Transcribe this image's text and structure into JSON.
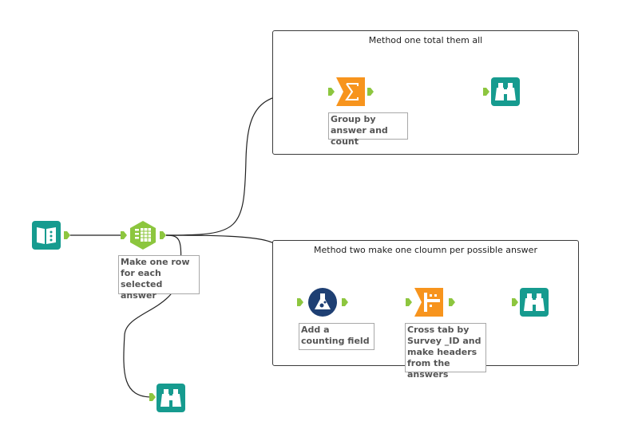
{
  "containers": {
    "method_one": {
      "title": "Method one total them all"
    },
    "method_two": {
      "title": "Method two make one cloumn per possible answer"
    }
  },
  "annotations": {
    "text_to_columns": "Make one row for each selected answer",
    "summarize": "Group by answer and count",
    "formula": "Add a counting field",
    "crosstab": "Cross tab by Survey _ID and make headers from the answers"
  },
  "tools": [
    {
      "id": "input",
      "icon": "book-input-icon"
    },
    {
      "id": "text_to_columns",
      "icon": "text-to-columns-icon"
    },
    {
      "id": "summarize",
      "icon": "sigma-icon"
    },
    {
      "id": "browse_1",
      "icon": "binoculars-icon"
    },
    {
      "id": "formula",
      "icon": "flask-icon"
    },
    {
      "id": "crosstab",
      "icon": "crosstab-icon"
    },
    {
      "id": "browse_2",
      "icon": "binoculars-icon"
    },
    {
      "id": "browse_3",
      "icon": "binoculars-icon"
    }
  ],
  "colors": {
    "teal": "#169B8F",
    "lime": "#8CC63E",
    "orange": "#F7941D",
    "navy": "#1E3F73",
    "anchor": "#8DC63F",
    "wire": "#222222"
  }
}
